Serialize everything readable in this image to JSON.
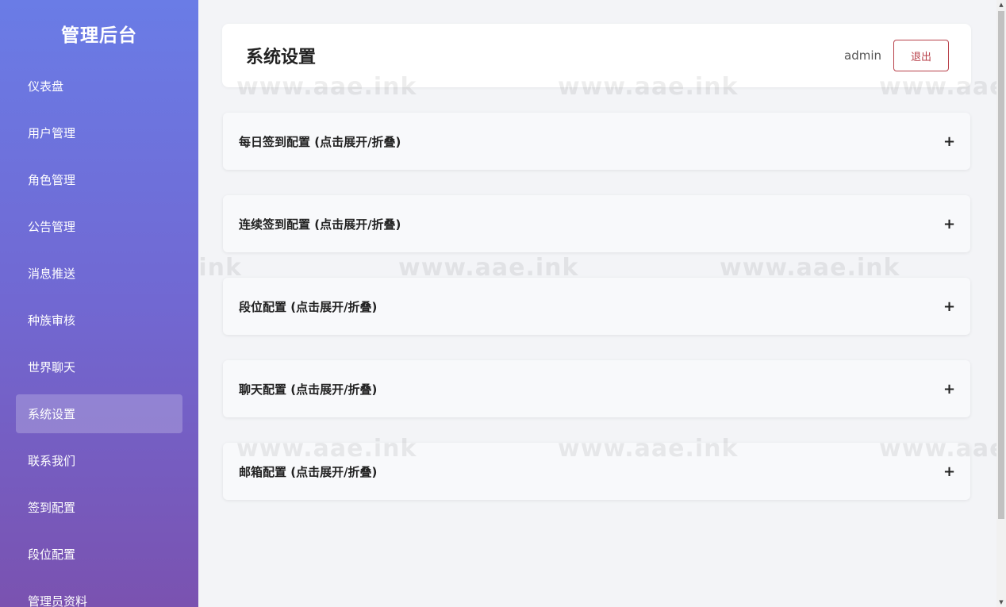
{
  "sidebar": {
    "brand": "管理后台",
    "items": [
      {
        "label": "仪表盘"
      },
      {
        "label": "用户管理"
      },
      {
        "label": "角色管理"
      },
      {
        "label": "公告管理"
      },
      {
        "label": "消息推送"
      },
      {
        "label": "种族审核"
      },
      {
        "label": "世界聊天"
      },
      {
        "label": "系统设置",
        "active": true
      },
      {
        "label": "联系我们"
      },
      {
        "label": "签到配置"
      },
      {
        "label": "段位配置"
      },
      {
        "label": "管理员资料"
      }
    ]
  },
  "header": {
    "title": "系统设置",
    "user": "admin",
    "logout_label": "退出"
  },
  "sections": [
    {
      "label": "每日签到配置 (点击展开/折叠)",
      "toggle": "+"
    },
    {
      "label": "连续签到配置 (点击展开/折叠)",
      "toggle": "+"
    },
    {
      "label": "段位配置 (点击展开/折叠)",
      "toggle": "+"
    },
    {
      "label": "聊天配置 (点击展开/折叠)",
      "toggle": "+"
    },
    {
      "label": "邮箱配置 (点击展开/折叠)",
      "toggle": "+"
    }
  ],
  "watermark": "www.aae.ink",
  "colors": {
    "sidebar_top": "#6a7ce6",
    "sidebar_bottom": "#7a52b0",
    "logout_accent": "#b8404a",
    "page_bg": "#f3f4f7"
  }
}
